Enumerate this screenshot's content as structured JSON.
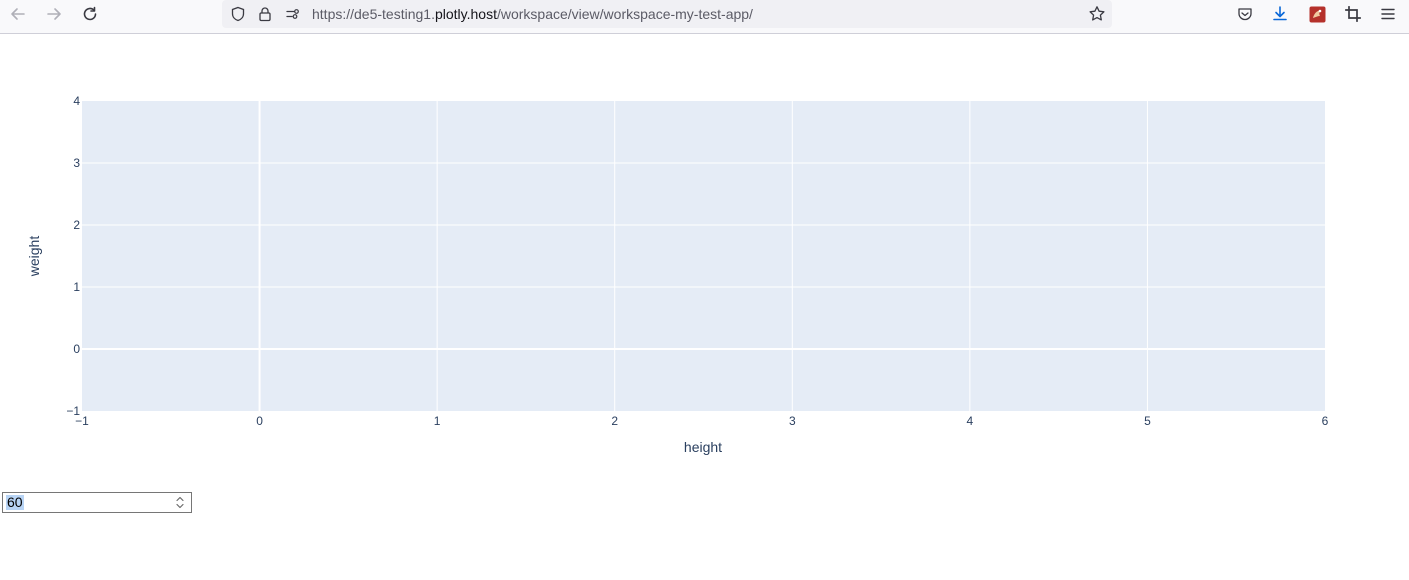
{
  "browser": {
    "url_prefix": "https://de5-testing1.",
    "url_domain": "plotly.host",
    "url_path": "/workspace/view/workspace-my-test-app/"
  },
  "number_input": {
    "value": "60"
  },
  "chart_data": {
    "type": "scatter",
    "xlabel": "height",
    "ylabel": "weight",
    "xlim": [
      -1,
      6
    ],
    "ylim": [
      -1,
      4
    ],
    "xticks": [
      "−1",
      "0",
      "1",
      "2",
      "3",
      "4",
      "5",
      "6"
    ],
    "yticks": [
      "−1",
      "0",
      "1",
      "2",
      "3",
      "4"
    ],
    "series": [],
    "grid": true,
    "colors": {
      "plot_bg": "#e5ecf6",
      "grid": "#ffffff",
      "text": "#2a3f5f"
    }
  }
}
